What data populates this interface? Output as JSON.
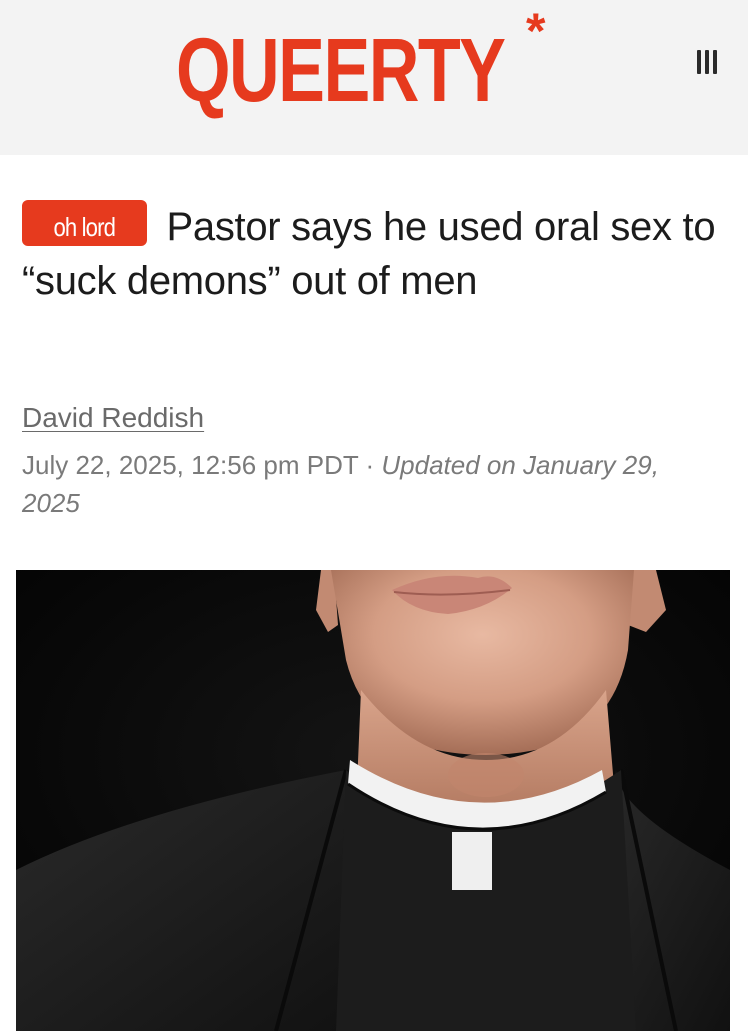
{
  "header": {
    "logo_text": "QUEERTY",
    "logo_mark": "*",
    "menu_icon": "hamburger-menu-icon"
  },
  "article": {
    "category_label": "oh lord",
    "title": "Pastor says he used oral sex to “suck demons” out of men",
    "author": "David Reddish",
    "published": "July 22, 2025, 12:56 pm PDT",
    "separator": " · ",
    "updated": "Updated on January 29, 2025"
  },
  "colors": {
    "brand": "#e63a1e",
    "header_bg": "#f3f3f3",
    "text": "#1c1c1c",
    "meta_text": "#7a7a7a"
  },
  "hero_image": {
    "subject": "photo of a man in a black clerical shirt with white collar, face cropped above the lips"
  }
}
